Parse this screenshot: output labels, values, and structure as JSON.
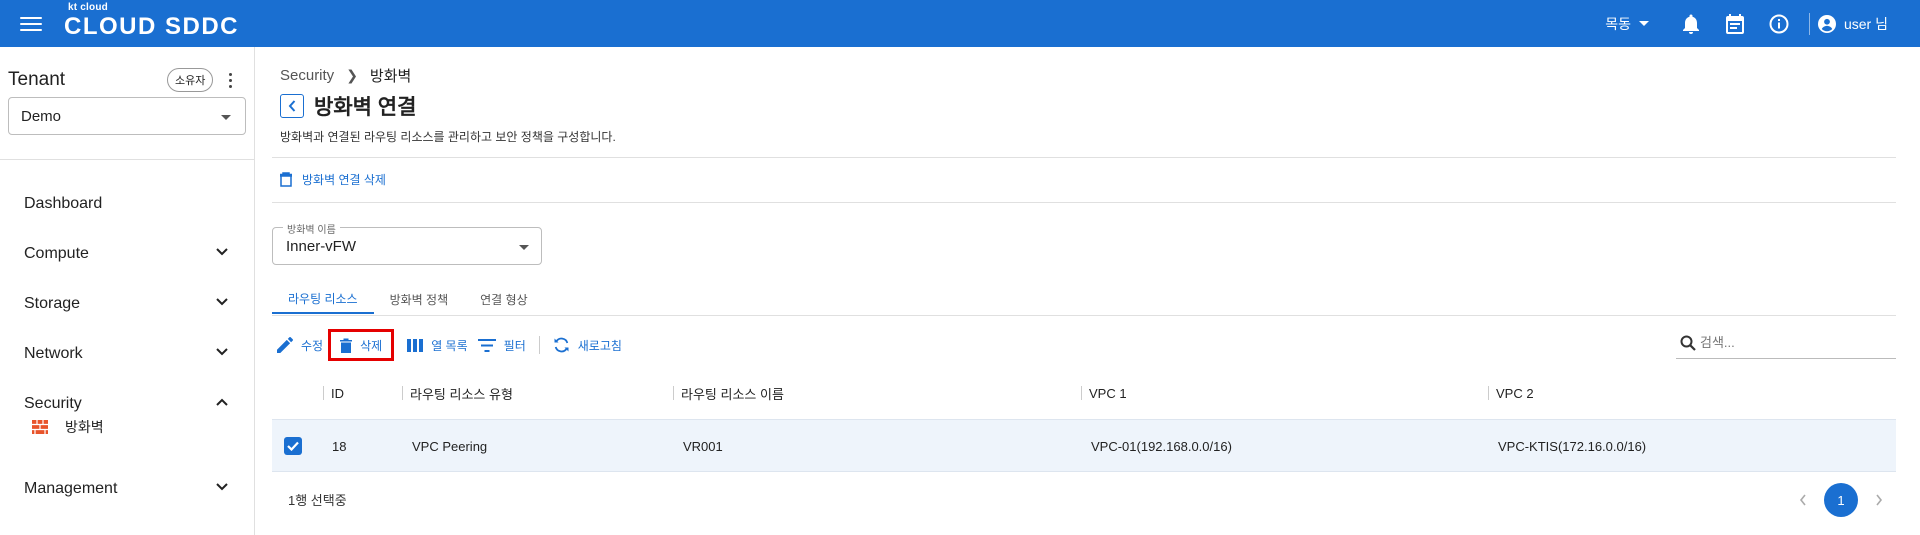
{
  "header": {
    "logo_sub": "kt cloud",
    "logo_main": "CLOUD SDDC",
    "location": "목동",
    "user": "user 님"
  },
  "sidebar": {
    "tenant_title": "Tenant",
    "owner_badge": "소유자",
    "tenant_value": "Demo",
    "items": [
      {
        "label": "Dashboard"
      },
      {
        "label": "Compute"
      },
      {
        "label": "Storage"
      },
      {
        "label": "Network"
      },
      {
        "label": "Security"
      },
      {
        "label": "Management"
      }
    ],
    "sub_items": [
      {
        "label": "방화벽"
      }
    ]
  },
  "main": {
    "breadcrumb": [
      "Security",
      "방화벽"
    ],
    "title": "방화벽 연결",
    "description": "방화벽과 연결된 라우팅 리소스를 관리하고 보안 정책을 구성합니다.",
    "delete_connection": "방화벽 연결 삭제",
    "firewall_select": {
      "label": "방화벽 이름",
      "value": "Inner-vFW"
    },
    "tabs": [
      {
        "label": "라우팅 리소스"
      },
      {
        "label": "방화벽 정책"
      },
      {
        "label": "연결 형상"
      }
    ],
    "toolbar": {
      "edit": "수정",
      "delete": "삭제",
      "columns": "열 목록",
      "filter": "필터",
      "refresh": "새로고침"
    },
    "search_placeholder": "검색...",
    "table": {
      "columns": [
        "ID",
        "라우팅 리소스 유형",
        "라우팅 리소스 이름",
        "VPC 1",
        "VPC 2"
      ],
      "rows": [
        {
          "id": "18",
          "type": "VPC Peering",
          "name": "VR001",
          "vpc1": "VPC-01(192.168.0.0/16)",
          "vpc2": "VPC-KTIS(172.16.0.0/16)"
        }
      ]
    },
    "selection_text": "1행 선택중",
    "page": "1"
  },
  "colors": {
    "primary": "#1a6fd1",
    "highlight": "#e50000",
    "firewall_icon": "#e8542b"
  }
}
